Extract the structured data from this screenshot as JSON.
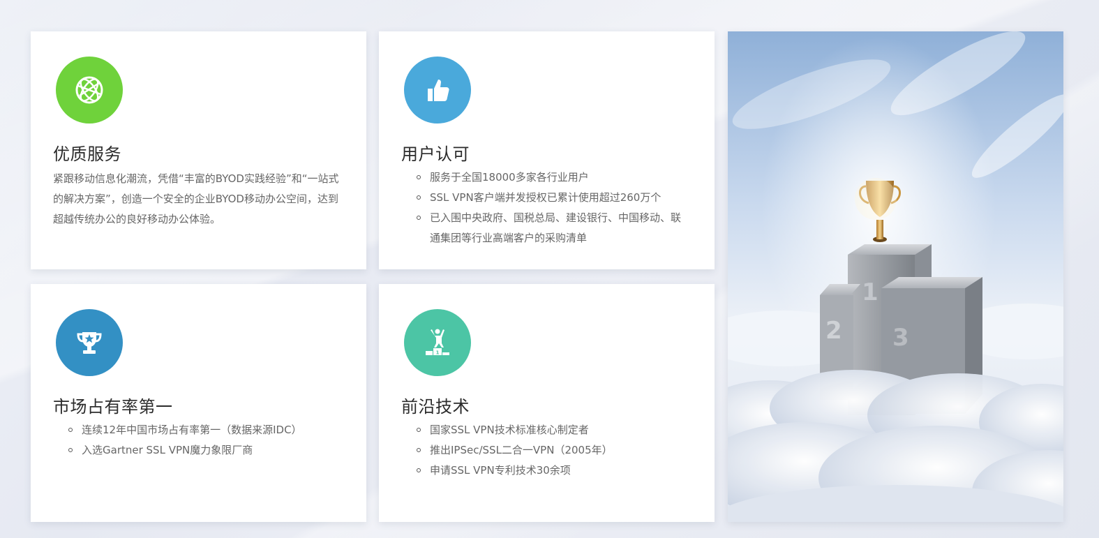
{
  "cards": [
    {
      "title": "优质服务",
      "icon": "globe-icon",
      "icon_color": "#6fd23b",
      "text": "紧跟移动信息化潮流，凭借“丰富的BYOD实践经验”和“一站式的解决方案”，创造一个安全的企业BYOD移动办公空间，达到超越传统办公的良好移动办公体验。"
    },
    {
      "title": "用户认可",
      "icon": "thumbs-up-icon",
      "icon_color": "#4aa9db",
      "items": [
        "服务于全国18000多家各行业用户",
        "SSL VPN客户端并发授权已累计使用超过260万个",
        "已入围中央政府、国税总局、建设银行、中国移动、联通集团等行业高端客户的采购清单"
      ]
    },
    {
      "title": "市场占有率第一",
      "icon": "trophy-icon",
      "icon_color": "#3390c4",
      "items": [
        "连续12年中国市场占有率第一（数据来源IDC）",
        "入选Gartner SSL VPN魔力象限厂商"
      ]
    },
    {
      "title": "前沿技术",
      "icon": "podium-winner-icon",
      "icon_color": "#4cc5a5",
      "items": [
        "国家SSL VPN技术标准核心制定者",
        "推出IPSec/SSL二合一VPN（2005年）",
        "申请SSL VPN专利技术30余项"
      ]
    }
  ],
  "photo": {
    "name": "trophy-podium-clouds-image",
    "podium_labels": [
      "1",
      "2",
      "3"
    ]
  }
}
